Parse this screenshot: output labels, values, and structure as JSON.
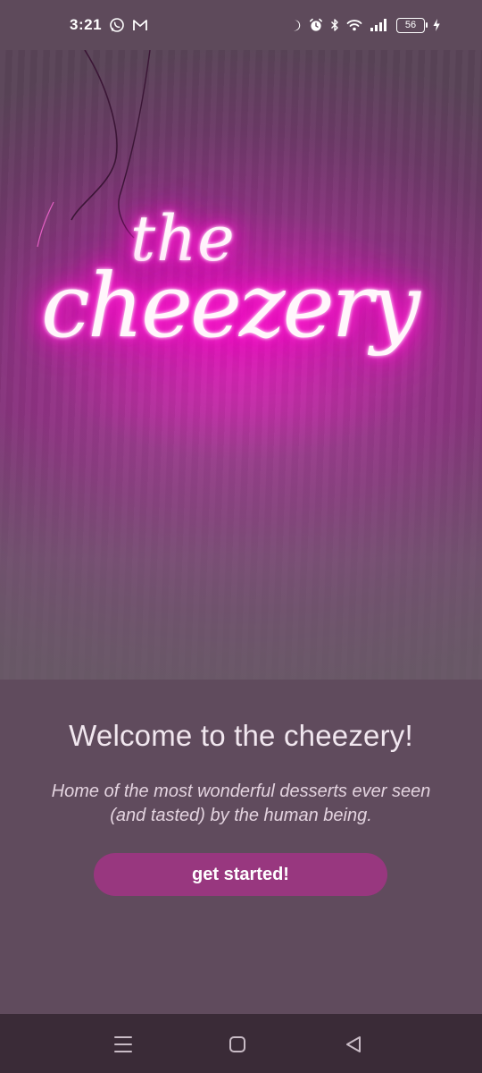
{
  "status_bar": {
    "time": "3:21",
    "battery_level": "56",
    "left_icons": [
      "whatsapp-icon",
      "gmail-icon"
    ],
    "right_icons": [
      "moon-icon",
      "alarm-icon",
      "bluetooth-icon",
      "wifi-icon",
      "signal-icon",
      "battery-icon",
      "charging-icon"
    ]
  },
  "hero": {
    "neon_line_1": "the",
    "neon_line_2": "cheezery",
    "neon_color": "#ff19cf"
  },
  "content": {
    "title": "Welcome to the cheezery!",
    "subtitle": "Home of the most wonderful desserts ever seen\n(and tasted) by the human being.",
    "cta_label": "get started!"
  },
  "nav_bar": {
    "icons": [
      "menu-icon",
      "home-icon",
      "back-icon"
    ]
  },
  "colors": {
    "background": "#604b5d",
    "accent": "#98377f",
    "nav_bar": "#3a2b37"
  }
}
